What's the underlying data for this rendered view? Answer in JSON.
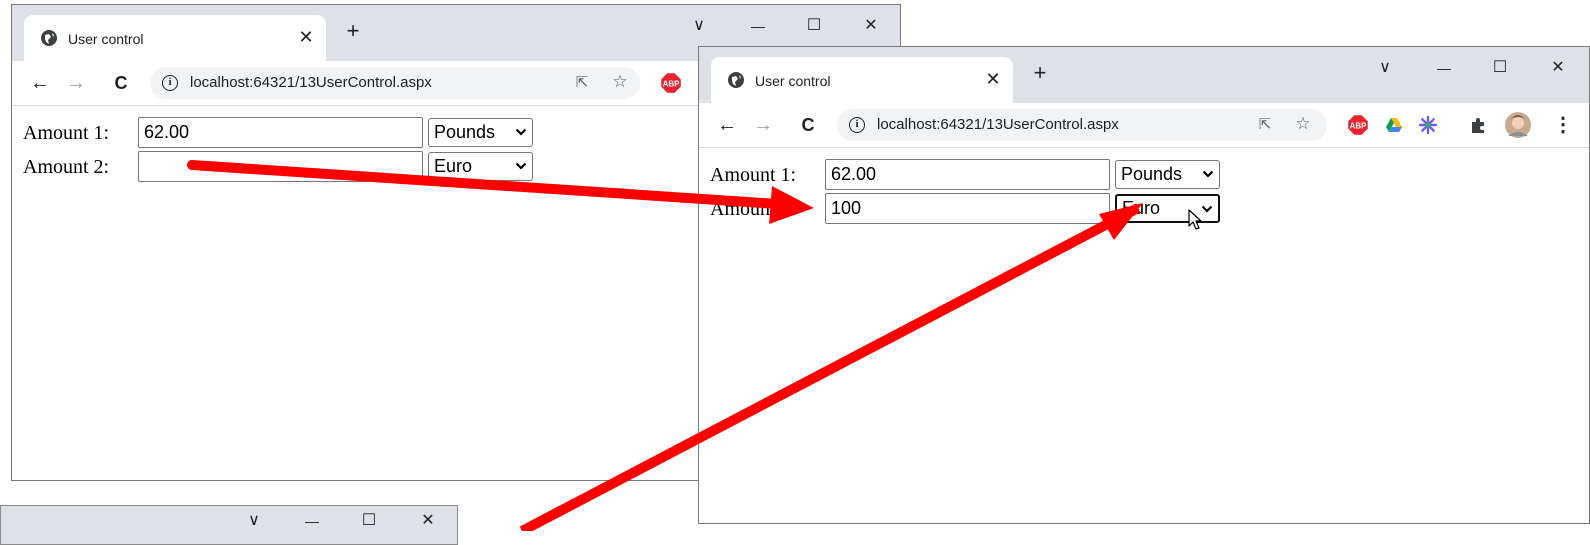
{
  "windows": [
    {
      "tab_title": "User control",
      "url": "localhost:64321/13UserControl.aspx",
      "amount1_label": "Amount 1:",
      "amount1_value": "62.00",
      "currency1": "Pounds",
      "amount2_label": "Amount 2:",
      "amount2_value": "",
      "currency2": "Euro"
    },
    {
      "tab_title": "User control",
      "url": "localhost:64321/13UserControl.aspx",
      "amount1_label": "Amount 1:",
      "amount1_value": "62.00",
      "currency1": "Pounds",
      "amount2_label": "Amount 2:",
      "amount2_value": "100",
      "currency2": "Euro"
    }
  ],
  "glyphs": {
    "close": "✕",
    "new_tab": "+",
    "back": "←",
    "forward": "→",
    "reload": "C",
    "star": "☆",
    "share": "⇱",
    "info": "i",
    "chevron": "∨",
    "minimize": "—",
    "maximize": "☐"
  },
  "colors": {
    "annotation_arrow": "#ff0000",
    "adblock_badge": "#e8232e",
    "tabstrip": "#dee1e6"
  },
  "annotation": {
    "arrows": [
      {
        "from": "window-1-amount2-field",
        "to": "window-2-amount2-field"
      },
      {
        "from": "window-2-currency2-select",
        "to": "third-window-below"
      }
    ]
  }
}
